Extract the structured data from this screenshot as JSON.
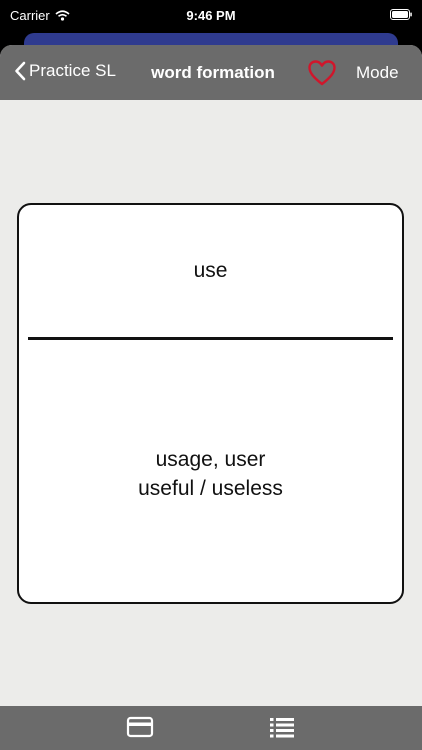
{
  "status_bar": {
    "carrier": "Carrier",
    "time": "9:46 PM"
  },
  "nav": {
    "back_label": "Practice SL",
    "title": "word formation",
    "mode_label": "Mode",
    "favorite_icon": "heart-outline-icon"
  },
  "card": {
    "front": "use",
    "back_line1": "usage, user",
    "back_line2": "useful / useless"
  },
  "toolbar": {
    "items": [
      {
        "icon": "card-icon"
      },
      {
        "icon": "list-icon"
      }
    ]
  },
  "colors": {
    "nav_background": "#6b6b6b",
    "sheet_background": "#ececea",
    "favorite_accent": "#d0162b",
    "behind_sheet": "#2f3b8f"
  }
}
